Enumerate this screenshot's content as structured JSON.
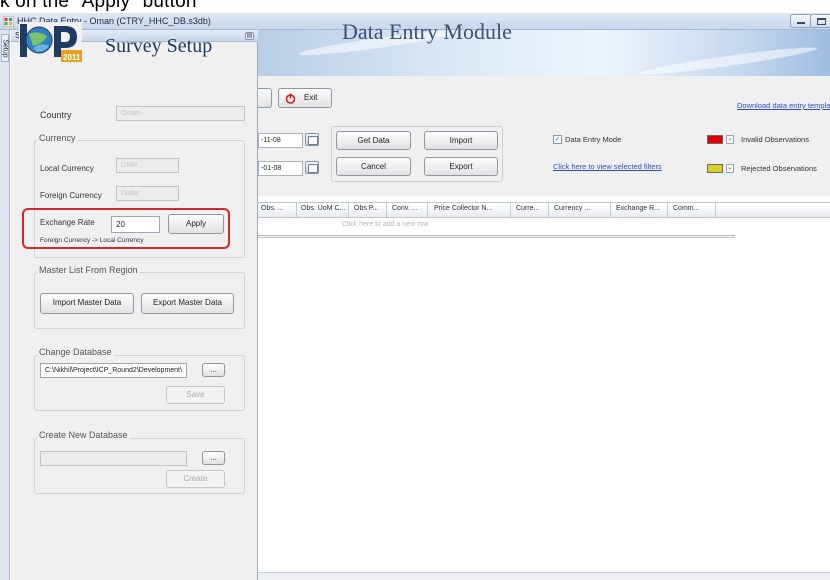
{
  "caption": "k on the \"Apply\" button",
  "window": {
    "title": "HHC Data Entry - Oman (CTRY_HHC_DB.s3db)"
  },
  "side_strip": {
    "tab_label": "Setup"
  },
  "setup_panel": {
    "header": "Setup",
    "pin_glyph": "▤",
    "logo": {
      "letters": "ICP",
      "year": "2011"
    },
    "title": "Survey Setup",
    "country": {
      "label": "Country",
      "value": "Oman"
    },
    "currency": {
      "group_title": "Currency",
      "local_label": "Local Currency",
      "local_value": "OMR",
      "foreign_label": "Foreign Currency",
      "foreign_value": "Dollar",
      "exchange_label": "Exchange Rate",
      "exchange_value": "20",
      "apply_label": "Apply",
      "direction_note": "Foreign Currency -> Local Currency"
    },
    "master_list": {
      "group_title": "Master List From Region",
      "import_label": "Import Master Data",
      "export_label": "Export Master Data"
    },
    "change_db": {
      "group_title": "Change Database",
      "path_value": "C:\\Nikhil\\Project\\ICP_Round2\\Development\\",
      "browse_label": "...",
      "save_label": "Save"
    },
    "new_db": {
      "group_title": "Create New Database",
      "path_value": "",
      "browse_label": "...",
      "create_label": "Create"
    }
  },
  "banner": {
    "title": "Data Entry Module"
  },
  "toolbar": {
    "exit_label": "Exit",
    "download_link": "Download data entry templa",
    "date_from": "-11-08",
    "date_to": "-01-08",
    "get_data_label": "Get Data",
    "import_label": "Import",
    "cancel_label": "Cancel",
    "export_label": "Export",
    "data_entry_mode_label": "Data Entry Mode",
    "data_entry_mode_checked": true,
    "view_filters_link": "Click here to view selected filters",
    "invalid_label": "Invalid Observations",
    "invalid_color": "#e00000",
    "rejected_label": "Rejected Observations",
    "rejected_color": "#d8cf28"
  },
  "grid": {
    "columns": [
      "Obs. ...",
      "Obs. UoM C...",
      "Obs P...",
      "Conv. ...",
      "Price Collector N...",
      "Curre...",
      "Currency ...",
      "Exchange R...",
      "Comm..."
    ],
    "add_row_hint": "Click here to add a new row"
  },
  "colors": {
    "highlight": "#d62a2a",
    "link": "#2a4fd0",
    "title_blue": "#1f3b63"
  }
}
